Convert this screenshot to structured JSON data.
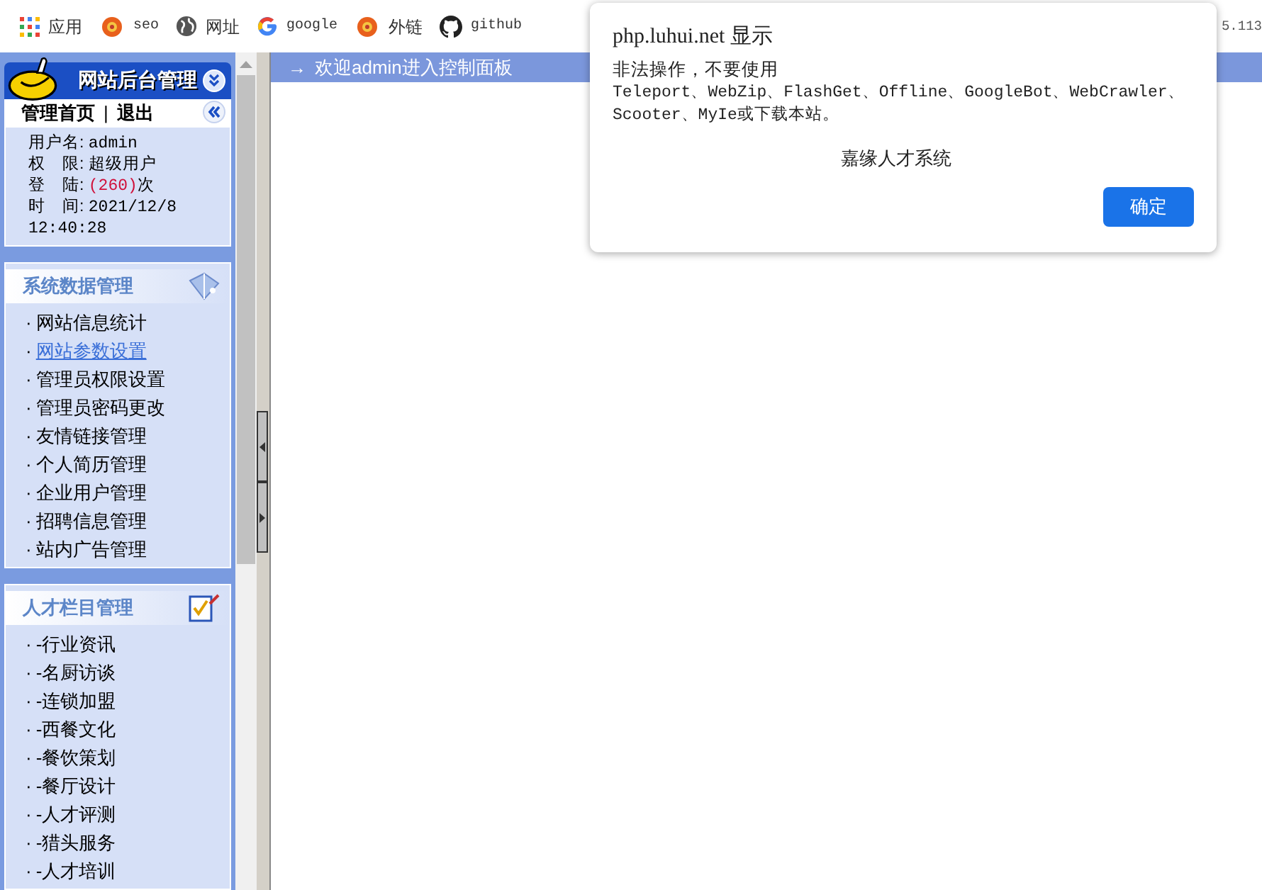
{
  "bookmarks_bar": {
    "items": [
      {
        "kind": "apps",
        "label": "应用"
      },
      {
        "kind": "flower",
        "label": "seo"
      },
      {
        "kind": "globe",
        "label": "网址"
      },
      {
        "kind": "google",
        "label": "google"
      },
      {
        "kind": "flower",
        "label": "外链"
      },
      {
        "kind": "github",
        "label": "github"
      }
    ],
    "overflow_text": "5.113"
  },
  "sidebar": {
    "title": "网站后台管理",
    "tabs": [
      "管理首页",
      "退出"
    ],
    "tab_separator": "|",
    "bullet": "·",
    "user_info": [
      {
        "label": "用户名:",
        "value": "admin"
      },
      {
        "label": "权　限:",
        "value": "超级用户"
      },
      {
        "label": "登　陆:",
        "value": "(260)",
        "suffix": "次"
      },
      {
        "label": "时　间:",
        "value": "2021/12/8 12:40:28"
      }
    ],
    "sections": [
      {
        "kind": "data",
        "title": "系统数据管理",
        "items": [
          {
            "label": "网站信息统计",
            "selected": false
          },
          {
            "label": "网站参数设置",
            "selected": true
          },
          {
            "label": "管理员权限设置",
            "selected": false
          },
          {
            "label": "管理员密码更改",
            "selected": false
          },
          {
            "label": "友情链接管理",
            "selected": false
          },
          {
            "label": "个人简历管理",
            "selected": false
          },
          {
            "label": "企业用户管理",
            "selected": false
          },
          {
            "label": "招聘信息管理",
            "selected": false
          },
          {
            "label": "站内广告管理",
            "selected": false
          }
        ]
      },
      {
        "kind": "edit",
        "title": "人才栏目管理",
        "items": [
          {
            "label": "-行业资讯",
            "selected": false
          },
          {
            "label": "-名厨访谈",
            "selected": false
          },
          {
            "label": "-连锁加盟",
            "selected": false
          },
          {
            "label": "-西餐文化",
            "selected": false
          },
          {
            "label": "-餐饮策划",
            "selected": false
          },
          {
            "label": "-餐厅设计",
            "selected": false
          },
          {
            "label": "-人才评测",
            "selected": false
          },
          {
            "label": "-猎头服务",
            "selected": false
          },
          {
            "label": "-人才培训",
            "selected": false
          }
        ]
      }
    ]
  },
  "main": {
    "header_arrow": "→",
    "header": "欢迎admin进入控制面板"
  },
  "dialog": {
    "title": "php.luhui.net 显示",
    "message_lines": [
      "非法操作，不要使用",
      "Teleport、WebZip、FlashGet、Offline、GoogleBot、WebCrawler、",
      "Scooter、MyIe或下载本站。"
    ],
    "signature": "嘉缘人才系统",
    "button": "确定"
  }
}
